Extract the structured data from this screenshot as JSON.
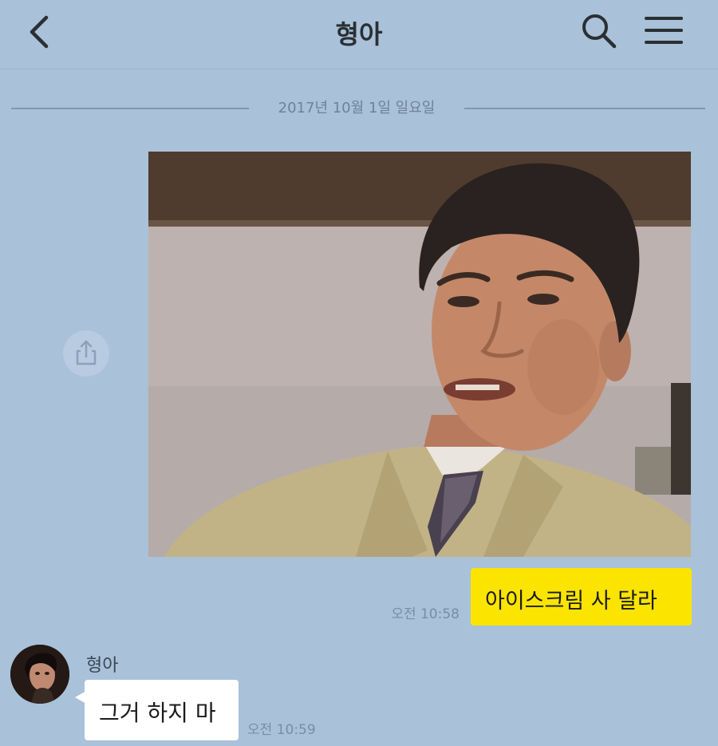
{
  "header": {
    "title": "형아",
    "back_icon": "chevron-left-icon",
    "search_icon": "search-icon",
    "menu_icon": "hamburger-menu-icon"
  },
  "date_divider": "2017년 10월 1일 일요일",
  "messages": [
    {
      "type": "image",
      "direction": "sent"
    },
    {
      "type": "text",
      "direction": "sent",
      "text": "아이스크림 사 달라",
      "time": "오전 10:58"
    },
    {
      "type": "text",
      "direction": "received",
      "sender": "형아",
      "text": "그거 하지 마",
      "time": "오전 10:59"
    }
  ],
  "colors": {
    "background": "#a9c1d9",
    "sent_bubble": "#fbe400",
    "received_bubble": "#ffffff"
  },
  "share_icon": "share-icon"
}
